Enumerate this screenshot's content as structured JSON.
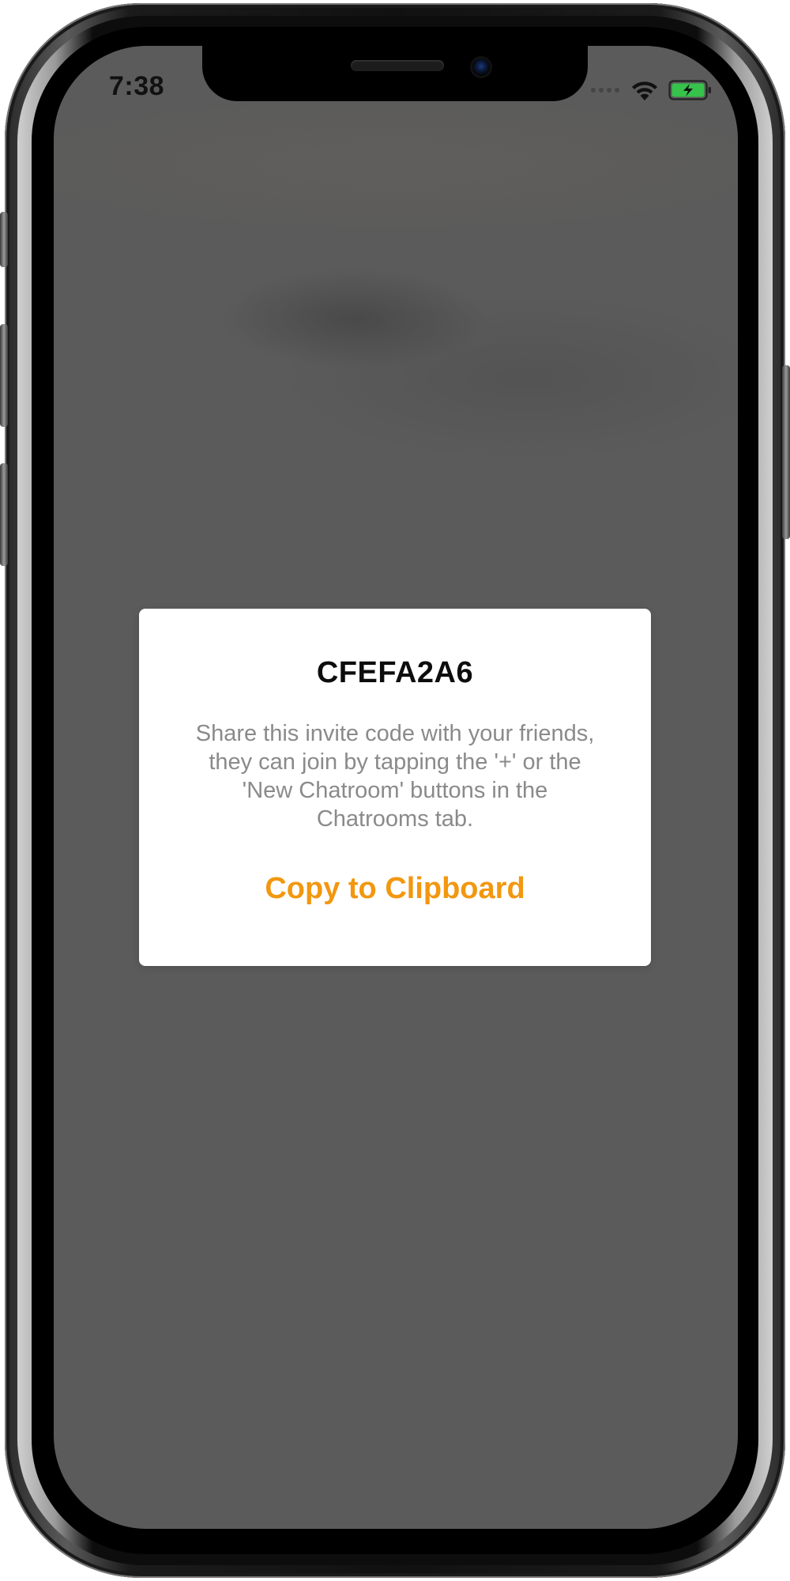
{
  "status_bar": {
    "time": "7:38",
    "icons": [
      "signal-dots-icon",
      "wifi-icon",
      "battery-charging-icon"
    ],
    "battery_color": "#36c24b"
  },
  "dialog": {
    "title": "CFEFA2A6",
    "message": "Share this invite code with your friends,\nthey can join by tapping the '+' or the\n'New Chatroom' buttons in the\nChatrooms tab.",
    "action_label": "Copy to Clipboard",
    "action_color": "#f2970f"
  },
  "colors": {
    "backdrop": "#5b5b5b",
    "dialog_background": "#ffffff",
    "message_text": "#8a8a8a"
  }
}
